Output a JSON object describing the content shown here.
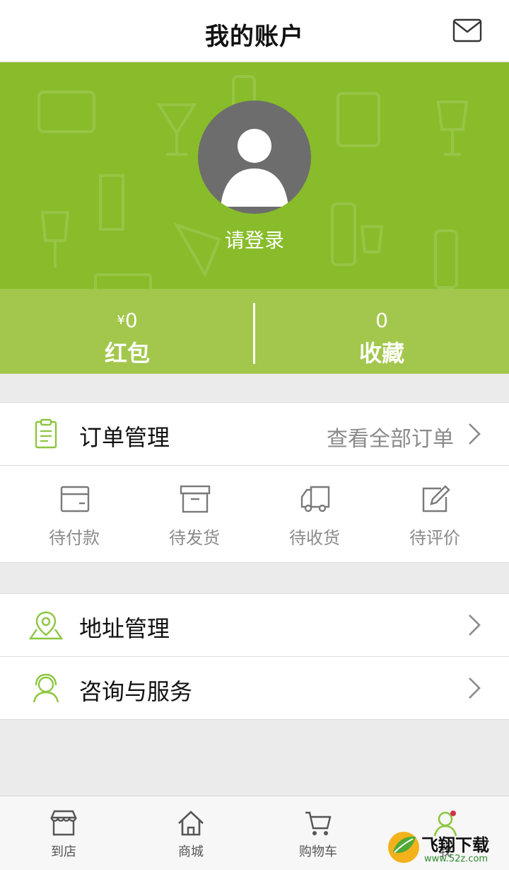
{
  "header": {
    "title": "我的账户",
    "mail_icon": "mail-icon"
  },
  "hero": {
    "login_text": "请登录",
    "background_color": "#88bc2a"
  },
  "stats": {
    "red_packet": {
      "currency": "¥",
      "value": "0",
      "label": "红包"
    },
    "favorites": {
      "value": "0",
      "label": "收藏"
    }
  },
  "orders": {
    "title": "订单管理",
    "view_all": "查看全部订单",
    "statuses": [
      {
        "label": "待付款",
        "icon": "wallet-icon"
      },
      {
        "label": "待发货",
        "icon": "box-icon"
      },
      {
        "label": "待收货",
        "icon": "truck-icon"
      },
      {
        "label": "待评价",
        "icon": "edit-icon"
      }
    ]
  },
  "menu": [
    {
      "label": "地址管理",
      "icon": "location-icon"
    },
    {
      "label": "咨询与服务",
      "icon": "service-icon"
    }
  ],
  "tabbar": {
    "tabs": [
      {
        "label": "到店",
        "icon": "store-icon"
      },
      {
        "label": "商城",
        "icon": "home-icon"
      },
      {
        "label": "购物车",
        "icon": "cart-icon"
      },
      {
        "label": "我",
        "icon": "user-icon"
      }
    ]
  },
  "watermark": {
    "text": "飞翔下载",
    "url": "www.52z.com"
  },
  "colors": {
    "accent": "#88bc2a",
    "accent_light": "#a2c74c",
    "icon_green": "#8cc63f"
  }
}
